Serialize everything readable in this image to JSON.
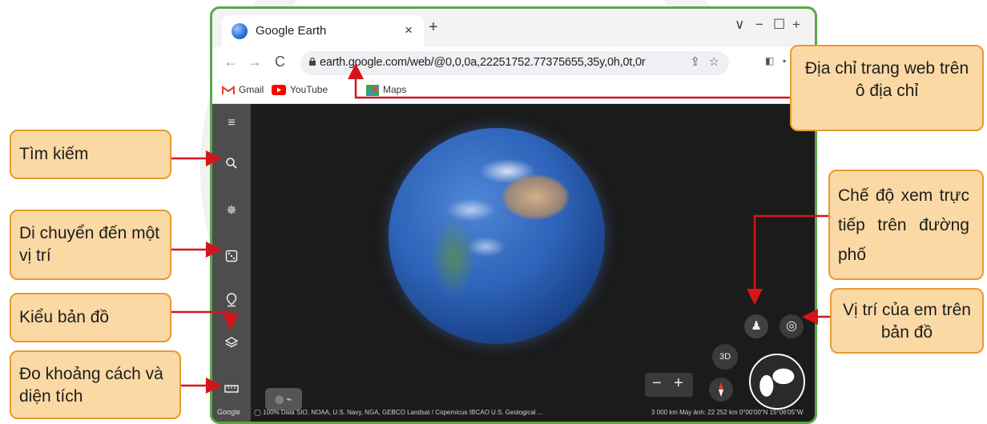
{
  "browser": {
    "tab_title": "Google Earth",
    "tab_close": "×",
    "new_tab": "+",
    "controls": [
      "∨",
      "−",
      "☐",
      "+"
    ],
    "url": "earth.google.com/web/@0,0,0a,22251752.77375655,35y,0h,0t,0r",
    "nav": [
      "←",
      "→",
      "C"
    ],
    "bookmarks": [
      {
        "label": "Gmail",
        "icon": "gmail-icon",
        "color": "#ea4335"
      },
      {
        "label": "YouTube",
        "icon": "youtube-icon",
        "color": "#ff0000"
      },
      {
        "label": "Maps",
        "icon": "maps-icon",
        "color": "#34a853"
      }
    ]
  },
  "earth": {
    "sidebar_icons": [
      "menu-icon",
      "search-icon",
      "voyager-icon",
      "feeling-lucky-icon",
      "projects-icon",
      "map-style-icon",
      "measure-icon"
    ],
    "btn_3d": "3D",
    "zoom_minus": "−",
    "zoom_plus": "+",
    "google_label": "Google",
    "attribution": "◯ 100%   Data SIO, NOAA, U.S. Navy, NGA, GEBCO  Landsat / Copernicus  IBCAO  U.S. Geological ...",
    "scale_camera": "3 000 km     Máy ảnh: 22 252 km   0°00'00\"N 15°06'05\"W"
  },
  "callouts": {
    "address": "Địa chỉ trang web trên ô địa chỉ",
    "search": "Tìm kiếm",
    "move": "Di chuyển đến một vị trí",
    "map_style": "Kiểu bản đồ",
    "measure": "Đo khoảng cách và diện tích",
    "street_view": "Chế độ xem trực tiếp trên đường phố",
    "my_location": "Vị trí của em trên bản đồ"
  },
  "colors": {
    "window_border": "#5aa845",
    "callout_fill": "#fbd9a4",
    "callout_border": "#e89a2f",
    "arrow": "#d4151b"
  }
}
